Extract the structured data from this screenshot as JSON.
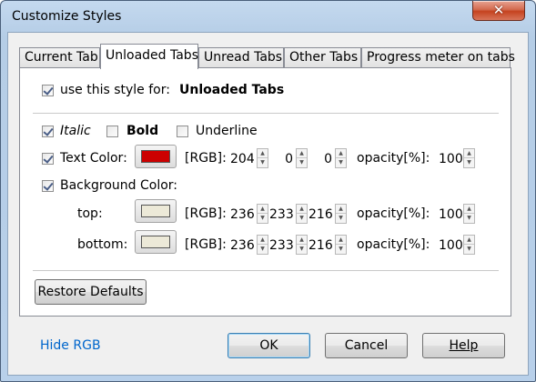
{
  "window": {
    "title": "Customize Styles",
    "close_symbol": "✕"
  },
  "tabs": [
    {
      "label": "Current Tab",
      "active": false
    },
    {
      "label": "Unloaded Tabs",
      "active": true
    },
    {
      "label": "Unread Tabs",
      "active": false
    },
    {
      "label": "Other Tabs",
      "active": false
    },
    {
      "label": "Progress meter on tabs",
      "active": false
    }
  ],
  "use_style": {
    "checked": true,
    "label": "use this style for:",
    "target": "Unloaded Tabs"
  },
  "font_style": {
    "italic": {
      "checked": true,
      "label": "Italic"
    },
    "bold": {
      "checked": false,
      "label": "Bold"
    },
    "underline": {
      "checked": false,
      "label": "Underline"
    }
  },
  "text_color": {
    "checked": true,
    "label": "Text Color:",
    "swatch": "#cc0000",
    "rgb_label": "[RGB]:",
    "r": "204",
    "g": "0",
    "b": "0",
    "opacity_label": "opacity[%]:",
    "opacity": "100"
  },
  "background_color": {
    "checked": true,
    "label": "Background Color:",
    "top": {
      "label": "top:",
      "swatch": "#ece9d8",
      "rgb_label": "[RGB]:",
      "r": "236",
      "g": "233",
      "b": "216",
      "opacity_label": "opacity[%]:",
      "opacity": "100"
    },
    "bottom": {
      "label": "bottom:",
      "swatch": "#ece9d8",
      "rgb_label": "[RGB]:",
      "r": "236",
      "g": "233",
      "b": "216",
      "opacity_label": "opacity[%]:",
      "opacity": "100"
    }
  },
  "restore_defaults": "Restore Defaults",
  "footer": {
    "hide_rgb": "Hide RGB",
    "ok": "OK",
    "cancel": "Cancel",
    "help": "Help"
  }
}
